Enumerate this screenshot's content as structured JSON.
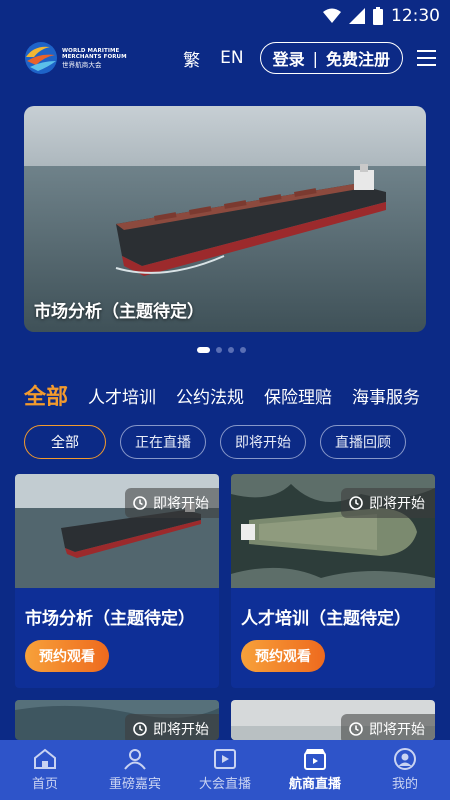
{
  "status_bar": {
    "time": "12:30"
  },
  "header": {
    "logo_en_line1": "WORLD MARITIME",
    "logo_en_line2": "MERCHANTS FORUM",
    "logo_cn": "世界航商大会",
    "lang_traditional": "繁",
    "lang_english": "EN",
    "login_label": "登录",
    "separator": "|",
    "register_label": "免费注册"
  },
  "banner": {
    "title": "市场分析（主题待定）",
    "slide_count": 4,
    "active_slide": 1
  },
  "category_tabs": [
    {
      "label": "全部",
      "active": true
    },
    {
      "label": "人才培训",
      "active": false
    },
    {
      "label": "公约法规",
      "active": false
    },
    {
      "label": "保险理赔",
      "active": false
    },
    {
      "label": "海事服务",
      "active": false
    }
  ],
  "filters": [
    {
      "label": "全部",
      "active": true
    },
    {
      "label": "正在直播",
      "active": false
    },
    {
      "label": "即将开始",
      "active": false
    },
    {
      "label": "直播回顾",
      "active": false
    }
  ],
  "cards": [
    {
      "badge": "即将开始",
      "title": "市场分析（主题待定）",
      "button": "预约观看"
    },
    {
      "badge": "即将开始",
      "title": "人才培训（主题待定）",
      "button": "预约观看"
    },
    {
      "badge": "即将开始"
    },
    {
      "badge": "即将开始"
    }
  ],
  "bottom_nav": [
    {
      "label": "首页",
      "icon": "home-icon",
      "active": false
    },
    {
      "label": "重磅嘉宾",
      "icon": "guest-icon",
      "active": false
    },
    {
      "label": "大会直播",
      "icon": "video-icon",
      "active": false
    },
    {
      "label": "航商直播",
      "icon": "clapper-icon",
      "active": true
    },
    {
      "label": "我的",
      "icon": "profile-icon",
      "active": false
    }
  ],
  "colors": {
    "background": "#0c2a86",
    "accent": "#f39a2d",
    "nav_bg": "#2e54c9",
    "card_bg": "#0e2f97"
  }
}
